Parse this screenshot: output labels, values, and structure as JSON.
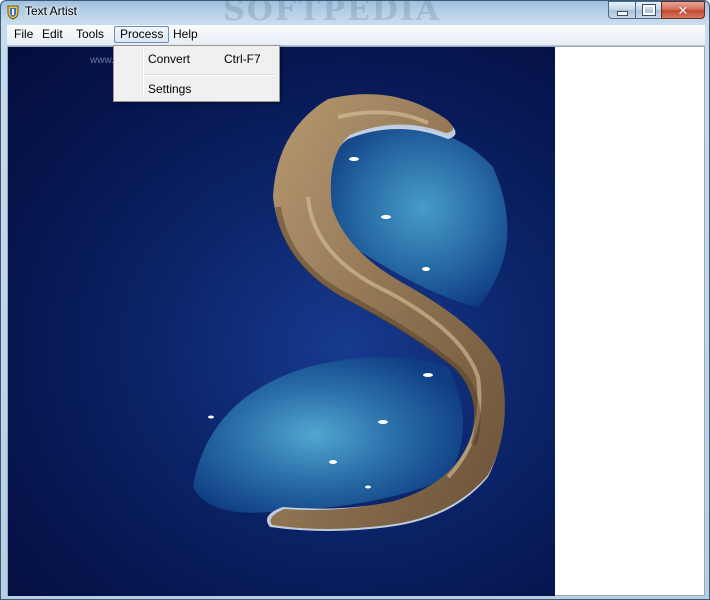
{
  "window": {
    "title": "Text Artist",
    "watermark": "SOFTPEDIA",
    "minimize_icon": "minimize-icon",
    "maximize_icon": "maximize-icon",
    "close_icon": "close-icon",
    "close_glyph": "✕"
  },
  "menu": {
    "items": [
      {
        "label": "File"
      },
      {
        "label": "Edit"
      },
      {
        "label": "Tools"
      },
      {
        "label": "Process"
      },
      {
        "label": "Help"
      }
    ],
    "active": "Process"
  },
  "process_menu": {
    "items": [
      {
        "label": "Convert",
        "shortcut": "Ctrl-F7"
      },
      {
        "label": "Settings",
        "shortcut": ""
      }
    ]
  },
  "canvas": {
    "url_watermark": "www.softpedia",
    "image_description": "aerial photo of crescent island",
    "colors": {
      "ocean": "#061650",
      "rock": "#9c8466",
      "lagoon": "#2f7fb0"
    }
  }
}
